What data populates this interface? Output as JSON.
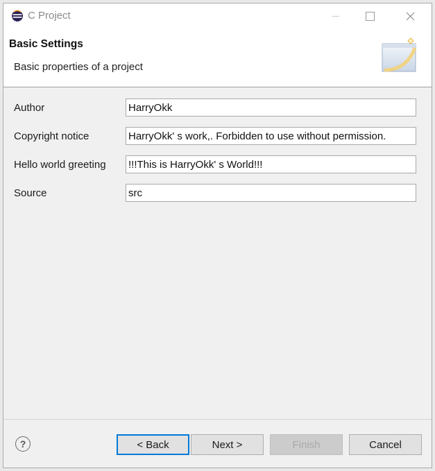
{
  "window": {
    "title": "C Project"
  },
  "header": {
    "title": "Basic Settings",
    "description": "Basic properties of a project"
  },
  "form": {
    "fields": [
      {
        "label": "Author",
        "value": "HarryOkk"
      },
      {
        "label": "Copyright notice",
        "value": "HarryOkk' s work,. Forbidden to use without permission."
      },
      {
        "label": "Hello world greeting",
        "value": "!!!This is HarryOkk' s World!!!"
      },
      {
        "label": "Source",
        "value": "src"
      }
    ]
  },
  "buttons": {
    "help": "?",
    "back": "< Back",
    "next": "Next >",
    "finish": "Finish",
    "cancel": "Cancel"
  },
  "state": {
    "finish_enabled": false,
    "default_button": "back"
  },
  "icons": {
    "app": "eclipse-icon",
    "wizard": "new-project-wizard-icon",
    "minimize": "minimize-icon",
    "maximize": "maximize-icon",
    "close": "close-icon",
    "help": "help-icon"
  },
  "colors": {
    "focus_border": "#0078d7",
    "header_bg": "#ffffff",
    "dialog_bg": "#f0f0f0"
  }
}
